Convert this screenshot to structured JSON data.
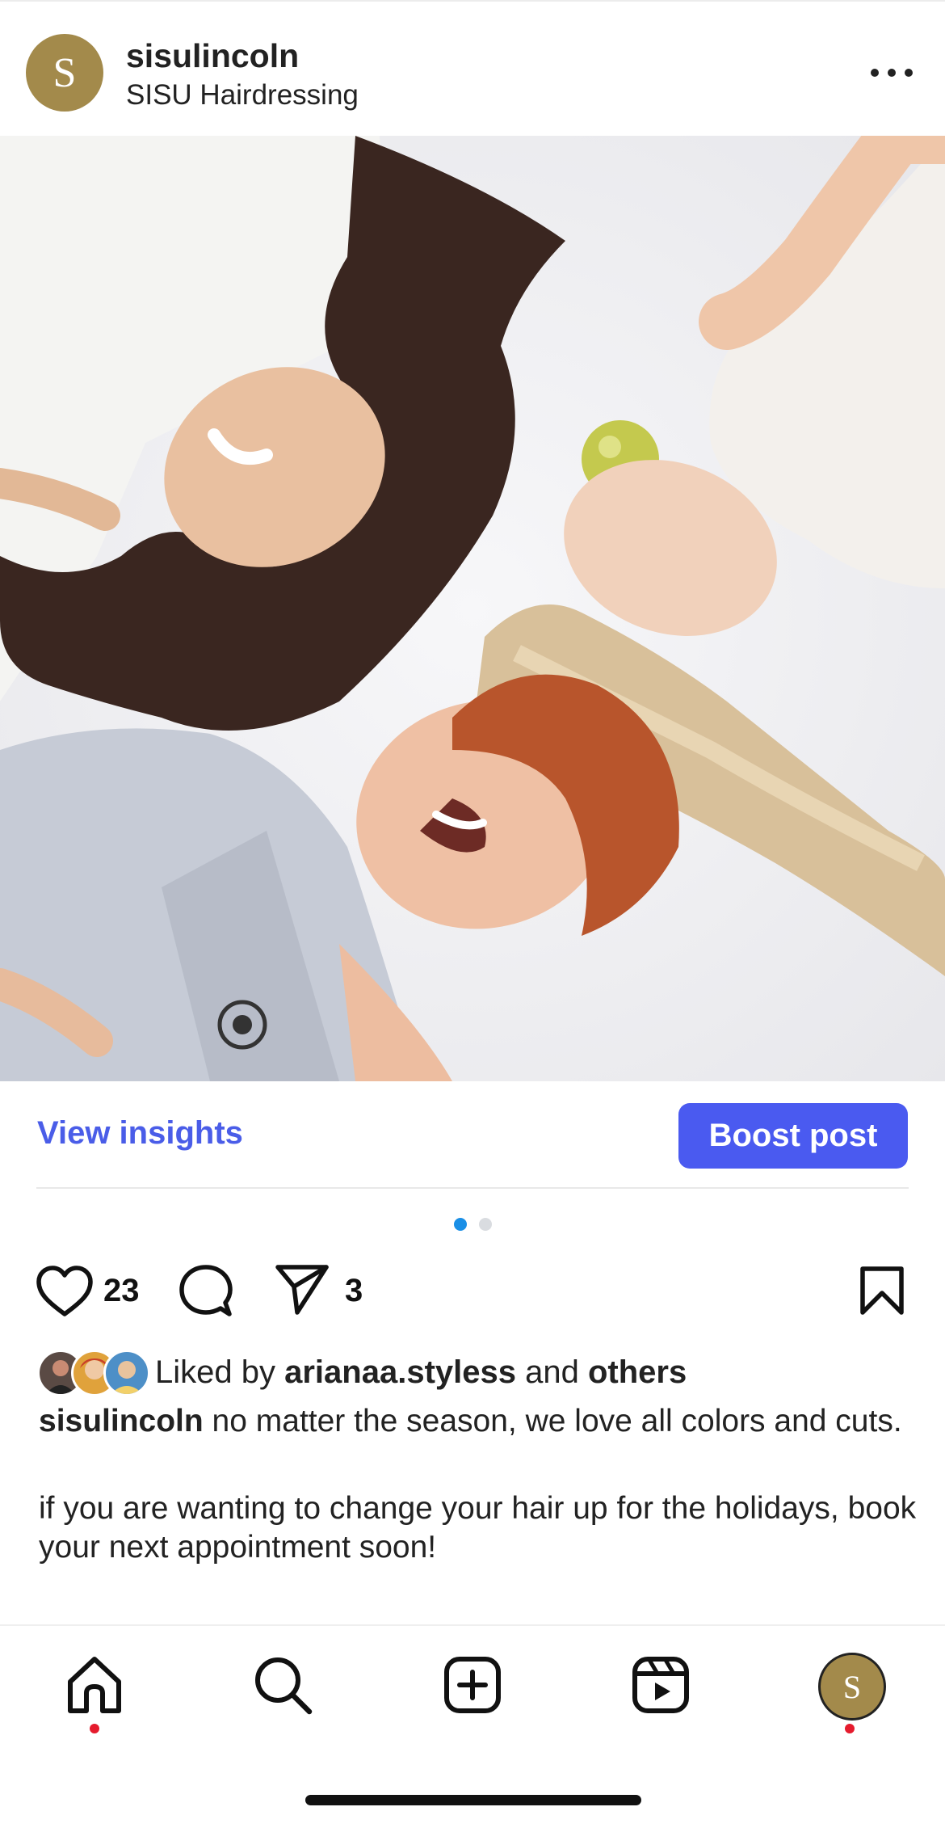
{
  "post": {
    "avatar_letter": "S",
    "username": "sisulincoln",
    "subtitle": "SISU Hairdressing",
    "more_icon": "more-horizontal-icon",
    "image_description_icon": "post-photo"
  },
  "insights": {
    "view_insights_label": "View insights",
    "boost_label": "Boost post"
  },
  "carousel": {
    "total": 2,
    "active_index": 0,
    "active_color": "#1a8fe6",
    "inactive_color": "#d9dce0"
  },
  "actions": {
    "like_count": "23",
    "share_count": "3"
  },
  "likes": {
    "liked_by_prefix": "Liked by",
    "liked_by_user": "arianaa.styless",
    "and_text": "and",
    "others_text": "others"
  },
  "caption": {
    "username": "sisulincoln",
    "line1": "no matter the season, we love all colors and cuts.",
    "line2": "if you are wanting to change your hair up for the holidays, book your next appointment soon!"
  },
  "tabbar": {
    "home_icon": "home-icon",
    "search_icon": "search-icon",
    "create_icon": "create-post-icon",
    "reels_icon": "reels-icon",
    "profile_letter": "S"
  },
  "colors": {
    "accent_blue": "#4a5af0",
    "link_blue": "#4a5de8",
    "avatar_gold": "#a38a4b",
    "notification_red": "#e51b2d"
  }
}
